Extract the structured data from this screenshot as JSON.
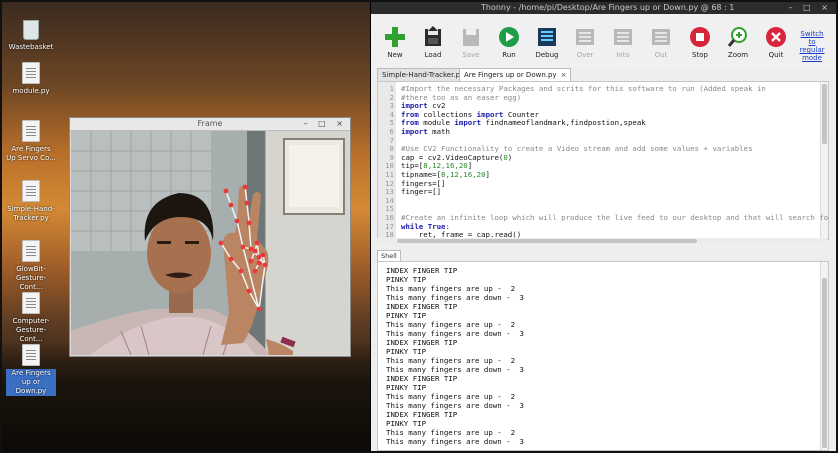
{
  "desktop": {
    "icons": [
      {
        "label": "Wastebasket",
        "kind": "trash"
      },
      {
        "label": "module.py",
        "kind": "doc"
      },
      {
        "label": "Are Fingers Up Servo Co...",
        "kind": "doc"
      },
      {
        "label": "Simple-Hand-Tracker.py",
        "kind": "doc"
      },
      {
        "label": "GlowBit-Gesture-Cont...",
        "kind": "doc"
      },
      {
        "label": "Computer-Gesture-Cont...",
        "kind": "doc"
      },
      {
        "label": "Are Fingers up or Down.py",
        "kind": "doc",
        "selected": true
      }
    ]
  },
  "camera_window": {
    "title": "Frame",
    "controls": "– □ ×"
  },
  "thonny": {
    "title": "Thonny - /home/pi/Desktop/Are Fingers up or Down.py @ 68 : 1",
    "controls": "– □ ×",
    "toolbar": [
      {
        "label": "New",
        "icon": "new-icon",
        "enabled": true
      },
      {
        "label": "Load",
        "icon": "load-icon",
        "enabled": true
      },
      {
        "label": "Save",
        "icon": "save-icon",
        "enabled": false
      },
      {
        "label": "Run",
        "icon": "run-icon",
        "enabled": true
      },
      {
        "label": "Debug",
        "icon": "debug-icon",
        "enabled": true
      },
      {
        "label": "Over",
        "icon": "step-over-icon",
        "enabled": false
      },
      {
        "label": "Into",
        "icon": "step-into-icon",
        "enabled": false
      },
      {
        "label": "Out",
        "icon": "step-out-icon",
        "enabled": false
      },
      {
        "label": "Stop",
        "icon": "stop-icon",
        "enabled": true
      },
      {
        "label": "Zoom",
        "icon": "zoom-icon",
        "enabled": true
      },
      {
        "label": "Quit",
        "icon": "quit-icon",
        "enabled": true
      }
    ],
    "switch_mode": "Switch to regular mode",
    "tabs": [
      {
        "label": "Simple-Hand-Tracker.py",
        "active": false
      },
      {
        "label": "Are Fingers up or Down.py",
        "active": true
      }
    ],
    "code": [
      {
        "n": "1",
        "parts": [
          [
            "c",
            "#Import the necessary Packages and scrits for this software to run (Added speak in"
          ]
        ]
      },
      {
        "n": "2",
        "parts": [
          [
            "c",
            "#there too as an easer egg)"
          ]
        ]
      },
      {
        "n": "3",
        "parts": [
          [
            "k",
            "import"
          ],
          [
            "p",
            " cv2"
          ]
        ]
      },
      {
        "n": "4",
        "parts": [
          [
            "k",
            "from"
          ],
          [
            "p",
            " collections "
          ],
          [
            "k",
            "import"
          ],
          [
            "p",
            " Counter"
          ]
        ]
      },
      {
        "n": "5",
        "parts": [
          [
            "k",
            "from"
          ],
          [
            "p",
            " module "
          ],
          [
            "k",
            "import"
          ],
          [
            "p",
            " findnameoflandmark,findpostion,speak"
          ]
        ]
      },
      {
        "n": "6",
        "parts": [
          [
            "k",
            "import"
          ],
          [
            "p",
            " math"
          ]
        ]
      },
      {
        "n": "7",
        "parts": []
      },
      {
        "n": "8",
        "parts": [
          [
            "c",
            "#Use CV2 Functionality to create a Video stream and add some values + variables"
          ]
        ]
      },
      {
        "n": "9",
        "parts": [
          [
            "p",
            "cap = cv2.VideoCapture("
          ],
          [
            "s",
            "0"
          ],
          [
            "p",
            ")"
          ]
        ]
      },
      {
        "n": "10",
        "parts": [
          [
            "p",
            "tip=["
          ],
          [
            "s",
            "8,12,16,20"
          ],
          [
            "p",
            "]"
          ]
        ]
      },
      {
        "n": "11",
        "parts": [
          [
            "p",
            "tipname=["
          ],
          [
            "s",
            "8,12,16,20"
          ],
          [
            "p",
            "]"
          ]
        ]
      },
      {
        "n": "12",
        "parts": [
          [
            "p",
            "fingers=[]"
          ]
        ]
      },
      {
        "n": "13",
        "parts": [
          [
            "p",
            "finger=[]"
          ]
        ]
      },
      {
        "n": "14",
        "parts": []
      },
      {
        "n": "15",
        "parts": []
      },
      {
        "n": "16",
        "parts": [
          [
            "c",
            "#Create an infinite loop which will produce the live feed to our desktop and that will search fo"
          ]
        ]
      },
      {
        "n": "17",
        "parts": [
          [
            "k",
            "while"
          ],
          [
            "p",
            " "
          ],
          [
            "k",
            "True"
          ],
          [
            "p",
            ":"
          ]
        ]
      },
      {
        "n": "18",
        "parts": [
          [
            "p",
            "    ret, frame = cap.read()"
          ]
        ]
      }
    ],
    "shell_label": "Shell",
    "shell": [
      "INDEX FINGER TIP",
      "PINKY TIP",
      "This many fingers are up -  2",
      "This many fingers are down -  3",
      "INDEX FINGER TIP",
      "PINKY TIP",
      "This many fingers are up -  2",
      "This many fingers are down -  3",
      "INDEX FINGER TIP",
      "PINKY TIP",
      "This many fingers are up -  2",
      "This many fingers are down -  3",
      "INDEX FINGER TIP",
      "PINKY TIP",
      "This many fingers are up -  2",
      "This many fingers are down -  3",
      "INDEX FINGER TIP",
      "PINKY TIP",
      "This many fingers are up -  2",
      "This many fingers are down -  3"
    ]
  },
  "colors": {
    "keyword": "#1b1bb0",
    "comment": "#8a8a8a",
    "string": "#248b24",
    "link": "#1a3ec8",
    "landmark": "#e83a3a"
  }
}
